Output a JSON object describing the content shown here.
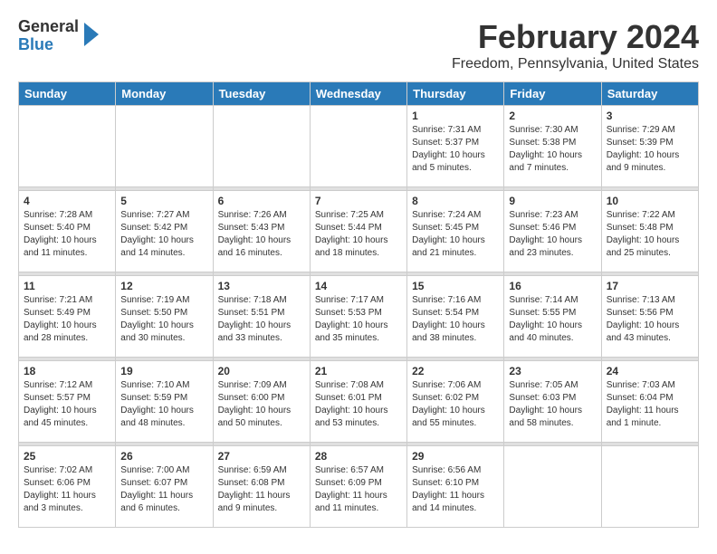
{
  "logo": {
    "general": "General",
    "blue": "Blue",
    "arrow": "▶"
  },
  "title": "February 2024",
  "location": "Freedom, Pennsylvania, United States",
  "weekdays": [
    "Sunday",
    "Monday",
    "Tuesday",
    "Wednesday",
    "Thursday",
    "Friday",
    "Saturday"
  ],
  "weeks": [
    [
      {
        "day": "",
        "info": ""
      },
      {
        "day": "",
        "info": ""
      },
      {
        "day": "",
        "info": ""
      },
      {
        "day": "",
        "info": ""
      },
      {
        "day": "1",
        "info": "Sunrise: 7:31 AM\nSunset: 5:37 PM\nDaylight: 10 hours\nand 5 minutes."
      },
      {
        "day": "2",
        "info": "Sunrise: 7:30 AM\nSunset: 5:38 PM\nDaylight: 10 hours\nand 7 minutes."
      },
      {
        "day": "3",
        "info": "Sunrise: 7:29 AM\nSunset: 5:39 PM\nDaylight: 10 hours\nand 9 minutes."
      }
    ],
    [
      {
        "day": "4",
        "info": "Sunrise: 7:28 AM\nSunset: 5:40 PM\nDaylight: 10 hours\nand 11 minutes."
      },
      {
        "day": "5",
        "info": "Sunrise: 7:27 AM\nSunset: 5:42 PM\nDaylight: 10 hours\nand 14 minutes."
      },
      {
        "day": "6",
        "info": "Sunrise: 7:26 AM\nSunset: 5:43 PM\nDaylight: 10 hours\nand 16 minutes."
      },
      {
        "day": "7",
        "info": "Sunrise: 7:25 AM\nSunset: 5:44 PM\nDaylight: 10 hours\nand 18 minutes."
      },
      {
        "day": "8",
        "info": "Sunrise: 7:24 AM\nSunset: 5:45 PM\nDaylight: 10 hours\nand 21 minutes."
      },
      {
        "day": "9",
        "info": "Sunrise: 7:23 AM\nSunset: 5:46 PM\nDaylight: 10 hours\nand 23 minutes."
      },
      {
        "day": "10",
        "info": "Sunrise: 7:22 AM\nSunset: 5:48 PM\nDaylight: 10 hours\nand 25 minutes."
      }
    ],
    [
      {
        "day": "11",
        "info": "Sunrise: 7:21 AM\nSunset: 5:49 PM\nDaylight: 10 hours\nand 28 minutes."
      },
      {
        "day": "12",
        "info": "Sunrise: 7:19 AM\nSunset: 5:50 PM\nDaylight: 10 hours\nand 30 minutes."
      },
      {
        "day": "13",
        "info": "Sunrise: 7:18 AM\nSunset: 5:51 PM\nDaylight: 10 hours\nand 33 minutes."
      },
      {
        "day": "14",
        "info": "Sunrise: 7:17 AM\nSunset: 5:53 PM\nDaylight: 10 hours\nand 35 minutes."
      },
      {
        "day": "15",
        "info": "Sunrise: 7:16 AM\nSunset: 5:54 PM\nDaylight: 10 hours\nand 38 minutes."
      },
      {
        "day": "16",
        "info": "Sunrise: 7:14 AM\nSunset: 5:55 PM\nDaylight: 10 hours\nand 40 minutes."
      },
      {
        "day": "17",
        "info": "Sunrise: 7:13 AM\nSunset: 5:56 PM\nDaylight: 10 hours\nand 43 minutes."
      }
    ],
    [
      {
        "day": "18",
        "info": "Sunrise: 7:12 AM\nSunset: 5:57 PM\nDaylight: 10 hours\nand 45 minutes."
      },
      {
        "day": "19",
        "info": "Sunrise: 7:10 AM\nSunset: 5:59 PM\nDaylight: 10 hours\nand 48 minutes."
      },
      {
        "day": "20",
        "info": "Sunrise: 7:09 AM\nSunset: 6:00 PM\nDaylight: 10 hours\nand 50 minutes."
      },
      {
        "day": "21",
        "info": "Sunrise: 7:08 AM\nSunset: 6:01 PM\nDaylight: 10 hours\nand 53 minutes."
      },
      {
        "day": "22",
        "info": "Sunrise: 7:06 AM\nSunset: 6:02 PM\nDaylight: 10 hours\nand 55 minutes."
      },
      {
        "day": "23",
        "info": "Sunrise: 7:05 AM\nSunset: 6:03 PM\nDaylight: 10 hours\nand 58 minutes."
      },
      {
        "day": "24",
        "info": "Sunrise: 7:03 AM\nSunset: 6:04 PM\nDaylight: 11 hours\nand 1 minute."
      }
    ],
    [
      {
        "day": "25",
        "info": "Sunrise: 7:02 AM\nSunset: 6:06 PM\nDaylight: 11 hours\nand 3 minutes."
      },
      {
        "day": "26",
        "info": "Sunrise: 7:00 AM\nSunset: 6:07 PM\nDaylight: 11 hours\nand 6 minutes."
      },
      {
        "day": "27",
        "info": "Sunrise: 6:59 AM\nSunset: 6:08 PM\nDaylight: 11 hours\nand 9 minutes."
      },
      {
        "day": "28",
        "info": "Sunrise: 6:57 AM\nSunset: 6:09 PM\nDaylight: 11 hours\nand 11 minutes."
      },
      {
        "day": "29",
        "info": "Sunrise: 6:56 AM\nSunset: 6:10 PM\nDaylight: 11 hours\nand 14 minutes."
      },
      {
        "day": "",
        "info": ""
      },
      {
        "day": "",
        "info": ""
      }
    ]
  ]
}
